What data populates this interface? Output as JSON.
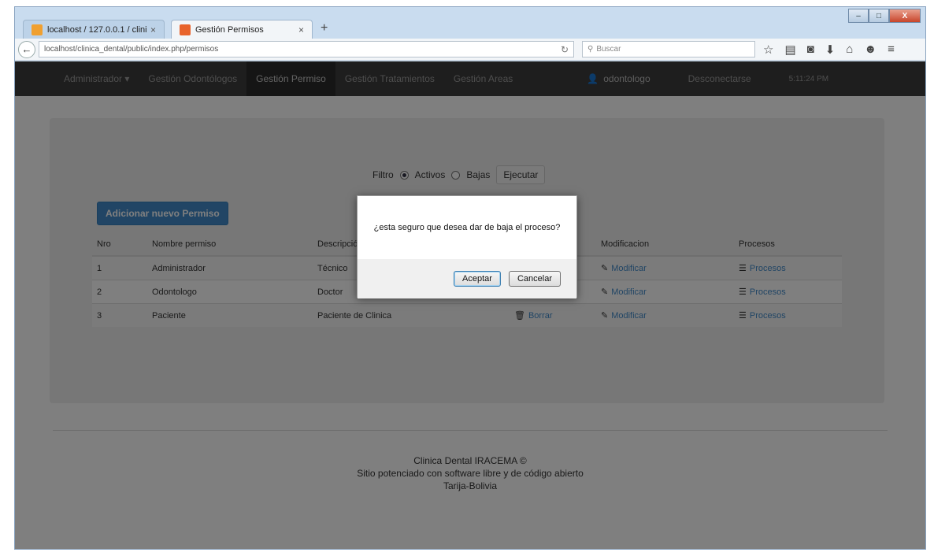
{
  "browser": {
    "tabs": [
      {
        "label": "localhost / 127.0.0.1 / clinic...",
        "close": "×"
      },
      {
        "label": "Gestión Permisos",
        "close": "×"
      }
    ],
    "new_tab": "+",
    "url": "localhost/clinica_dental/public/index.php/permisos",
    "search_placeholder": "Buscar",
    "window_controls": [
      "–",
      "□",
      "X"
    ]
  },
  "appnav": {
    "items": [
      "Administrador ▾",
      "Gestión Odontólogos",
      "Gestión Permiso",
      "Gestión Tratamientos",
      "Gestión Areas"
    ],
    "user": "odontologo",
    "logout": "Desconectarse",
    "time": "5:11:24 PM"
  },
  "filter": {
    "label": "Filtro",
    "option_active": "Activos",
    "option_inactive": "Bajas",
    "run_button": "Ejecutar"
  },
  "add_button": "Adicionar nuevo Permiso",
  "table": {
    "headers": [
      "Nro",
      "Nombre permiso",
      "Descripción",
      "",
      "Modificacion",
      "Procesos"
    ],
    "rows": [
      {
        "nro": "1",
        "name": "Administrador",
        "desc": "Técnico",
        "delete": "",
        "modify": "Modificar",
        "process": "Procesos"
      },
      {
        "nro": "2",
        "name": "Odontologo",
        "desc": "Doctor",
        "delete": "",
        "modify": "Modificar",
        "process": "Procesos"
      },
      {
        "nro": "3",
        "name": "Paciente",
        "desc": "Paciente de Clinica",
        "delete": "Borrar",
        "modify": "Modificar",
        "process": "Procesos"
      }
    ]
  },
  "footer": {
    "line1": "Clinica Dental IRACEMA ©",
    "line2": "Sitio potenciado con software libre y de código abierto",
    "line3": "Tarija-Bolivia"
  },
  "dialog": {
    "message": "¿esta seguro que desea dar de baja el proceso?",
    "accept": "Aceptar",
    "cancel": "Cancelar"
  },
  "colors": {
    "primary": "#428bca",
    "navbar": "#3c3c3c"
  }
}
